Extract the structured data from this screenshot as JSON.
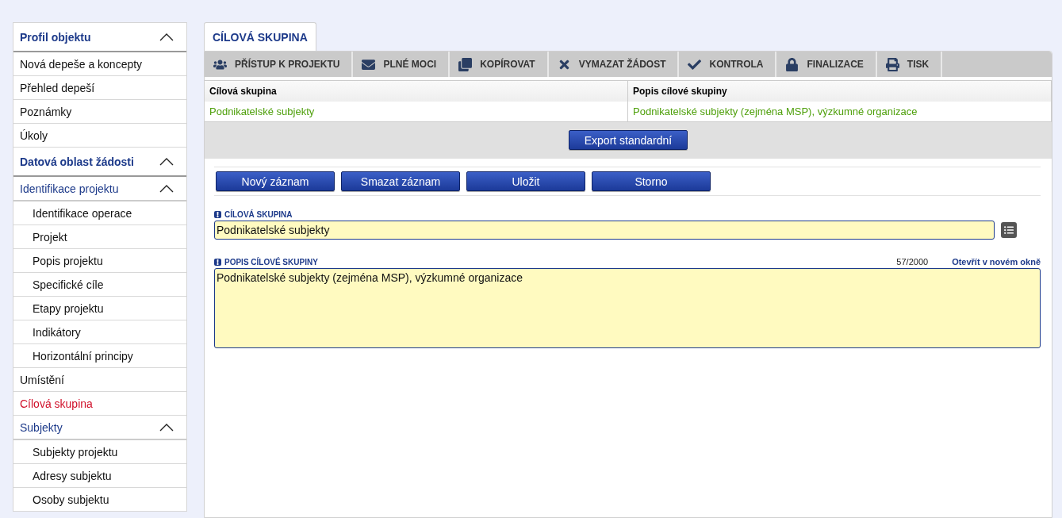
{
  "sidebar": {
    "sections": [
      {
        "label": "Profil objektu",
        "expanded": true,
        "children": [
          {
            "label": "Nová depeše a koncepty",
            "selected": false
          },
          {
            "label": "Přehled depeší",
            "selected": false
          },
          {
            "label": "Poznámky",
            "selected": false
          },
          {
            "label": "Úkoly",
            "selected": false
          }
        ]
      },
      {
        "label": "Datová oblast žádosti",
        "expanded": true,
        "children": [
          {
            "label": "Identifikace projektu",
            "selected": false,
            "expanded": true,
            "children": [
              {
                "label": "Identifikace operace",
                "selected": false
              },
              {
                "label": "Projekt",
                "selected": false
              },
              {
                "label": "Popis projektu",
                "selected": false
              },
              {
                "label": "Specifické cíle",
                "selected": false
              },
              {
                "label": "Etapy projektu",
                "selected": false
              },
              {
                "label": "Indikátory",
                "selected": false
              },
              {
                "label": "Horizontální principy",
                "selected": false
              }
            ]
          },
          {
            "label": "Umístění",
            "selected": false
          },
          {
            "label": "Cílová skupina",
            "selected": true
          },
          {
            "label": "Subjekty",
            "selected": false,
            "expanded": true,
            "children": [
              {
                "label": "Subjekty projektu",
                "selected": false
              },
              {
                "label": "Adresy subjektu",
                "selected": false
              },
              {
                "label": "Osoby subjektu",
                "selected": false
              }
            ]
          }
        ]
      }
    ]
  },
  "tabs": [
    {
      "label": "CÍLOVÁ SKUPINA",
      "selected": true
    }
  ],
  "toolbar": [
    {
      "kind": "people",
      "label": "PŘÍSTUP K PROJEKTU"
    },
    {
      "kind": "mail",
      "label": "PLNÉ MOCI"
    },
    {
      "kind": "copy",
      "label": "KOPÍROVAT"
    },
    {
      "kind": "delete",
      "label": "VYMAZAT ŽÁDOST"
    },
    {
      "kind": "check",
      "label": "KONTROLA"
    },
    {
      "kind": "lock",
      "label": "FINALIZACE"
    },
    {
      "kind": "print",
      "label": "TISK"
    }
  ],
  "table": {
    "columns": [
      "Cílová skupina",
      "Popis cílové skupiny"
    ],
    "rows": [
      {
        "cells": [
          "Podnikatelské subjekty",
          "Podnikatelské subjekty (zejména MSP), výzkumné organizace"
        ],
        "selected": false
      }
    ]
  },
  "export_button": "Export standardní",
  "actions": [
    "Nový záznam",
    "Smazat záznam",
    "Uložit",
    "Storno"
  ],
  "fields": [
    {
      "kind": "select",
      "label": "CÍLOVÁ SKUPINA",
      "required": true,
      "value": "Podnikatelské subjekty"
    },
    {
      "kind": "textarea",
      "label": "POPIS CÍLOVÉ SKUPINY",
      "required": true,
      "value": "Podnikatelské subjekty (zejména MSP), výzkumné organizace",
      "counter": "57/2000",
      "link": "Otevřít v novém okně"
    }
  ]
}
